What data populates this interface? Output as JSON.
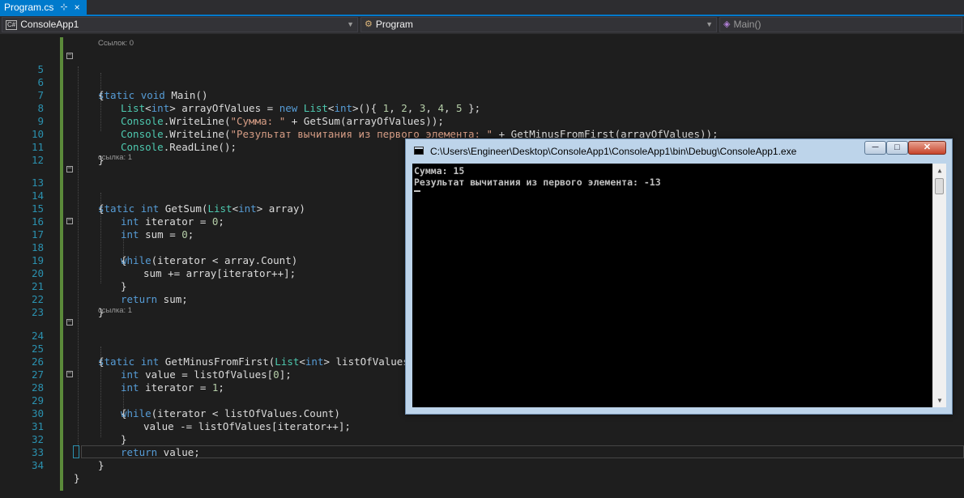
{
  "tab": {
    "label": "Program.cs",
    "pin": "⊹",
    "close": "×"
  },
  "navbar": {
    "project": "ConsoleApp1",
    "project_icon": "C#",
    "class": "Program",
    "member": "Main()"
  },
  "refs": {
    "r0": "Ссылок: 0",
    "r1": "ссылка: 1",
    "r2": "ссылка: 1"
  },
  "line_numbers": [
    "5",
    "6",
    "7",
    "8",
    "9",
    "10",
    "11",
    "12",
    "13",
    "14",
    "15",
    "16",
    "17",
    "18",
    "19",
    "20",
    "21",
    "22",
    "23",
    "24",
    "25",
    "26",
    "27",
    "28",
    "29",
    "30",
    "31",
    "32",
    "33",
    "34"
  ],
  "code": {
    "l5_kw1": "static",
    "l5_kw2": "void",
    "l5_rest": " Main()",
    "brace_open": "{",
    "brace_close": "}",
    "l7_a": "List",
    "l7_b": "<",
    "l7_c": "int",
    "l7_d": "> arrayOfValues = ",
    "l7_e": "new",
    "l7_f": " ",
    "l7_g": "List",
    "l7_h": "<",
    "l7_i": "int",
    "l7_j": ">(){ ",
    "l7_n1": "1",
    "l7_n2": "2",
    "l7_n3": "3",
    "l7_n4": "4",
    "l7_n5": "5",
    "l7_end": " };",
    "console": "Console",
    "l8_mid": ".WriteLine(",
    "l8_str": "\"Сумма: \"",
    "l8_end": " + GetSum(arrayOfValues));",
    "l9_mid": ".WriteLine(",
    "l9_str": "\"Результат вычитания из первого элемента: \"",
    "l9_end": " + GetMinusFromFirst(arrayOfValues));",
    "l10_end": ".ReadLine();",
    "l13_kw": "static",
    "l13_t": "int",
    "l13_mid": " GetSum(",
    "l13_list": "List",
    "l13_int": "int",
    "l13_end": "> array)",
    "l15_t": "int",
    "l15_rest": " iterator = ",
    "l15_n": "0",
    "l15_end": ";",
    "l16_t": "int",
    "l16_rest": " sum = ",
    "l16_n": "0",
    "l16_end": ";",
    "l17_kw": "while",
    "l17_rest": "(iterator < array.Count)",
    "l19": "sum += array[iterator++];",
    "l21_kw": "return",
    "l21_rest": " sum;",
    "l24_kw": "static",
    "l24_t": "int",
    "l24_mid": " GetMinusFromFirst(",
    "l24_list": "List",
    "l24_int": "int",
    "l24_end": "> listOfValues)",
    "l26_t": "int",
    "l26_rest": " value = listOfValues[",
    "l26_n": "0",
    "l26_end": "];",
    "l27_t": "int",
    "l27_rest": " iterator = ",
    "l27_n": "1",
    "l27_end": ";",
    "l28_kw": "while",
    "l28_rest": "(iterator < listOfValues.Count)",
    "l30": "value -= listOfValues[iterator++];",
    "l32_kw": "return",
    "l32_rest": " value;"
  },
  "console_window": {
    "title": "C:\\Users\\Engineer\\Desktop\\ConsoleApp1\\ConsoleApp1\\bin\\Debug\\ConsoleApp1.exe",
    "minimize": "─",
    "maximize": "□",
    "close": "✕",
    "output": [
      "Сумма: 15",
      "Результат вычитания из первого элемента: -13"
    ]
  }
}
